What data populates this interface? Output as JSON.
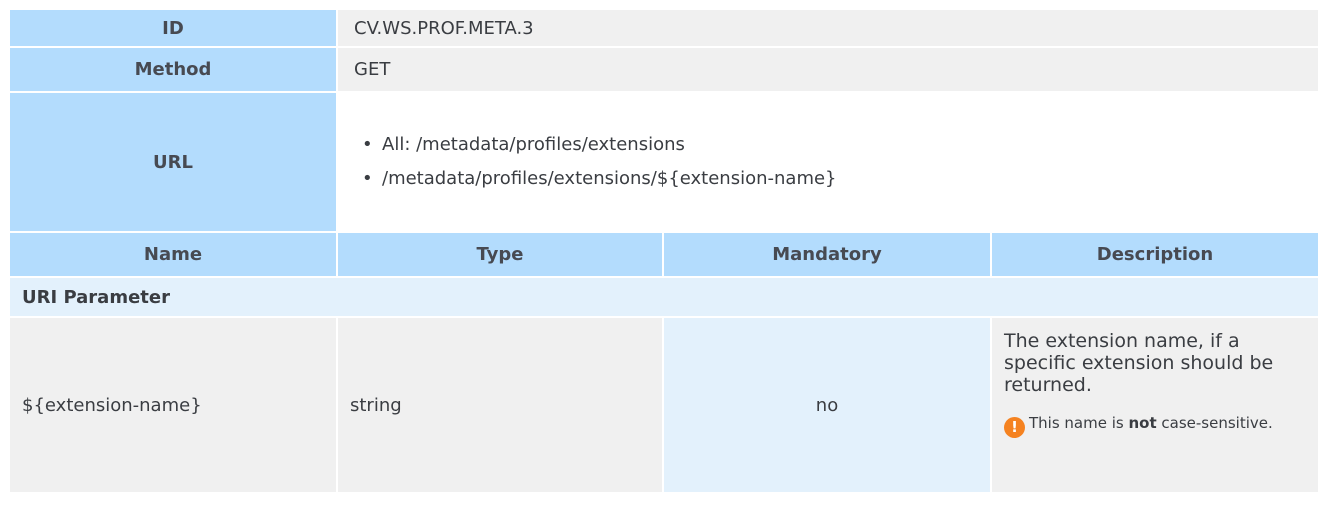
{
  "spec": {
    "id_label": "ID",
    "id_value": "CV.WS.PROF.META.3",
    "method_label": "Method",
    "method_value": "GET",
    "url_label": "URL",
    "urls": [
      "All: /metadata/profiles/extensions",
      "/metadata/profiles/extensions/${extension-name}"
    ]
  },
  "columns": [
    "Name",
    "Type",
    "Mandatory",
    "Description"
  ],
  "section": "URI Parameter",
  "parameter": {
    "name": "${extension-name}",
    "type": "string",
    "mandatory": "no",
    "description": "The extension name, if a specific extension should be returned.",
    "note_before": "This name is ",
    "note_bold": "not",
    "note_after": " case-sensitive.",
    "note_icon_glyph": "!",
    "note_icon": "warning-icon",
    "note_icon_color": "#f58220"
  },
  "colors": {
    "header_bg": "#b3dcfd",
    "row_bg": "#f0f0f0",
    "section_bg": "#e3f1fc"
  }
}
